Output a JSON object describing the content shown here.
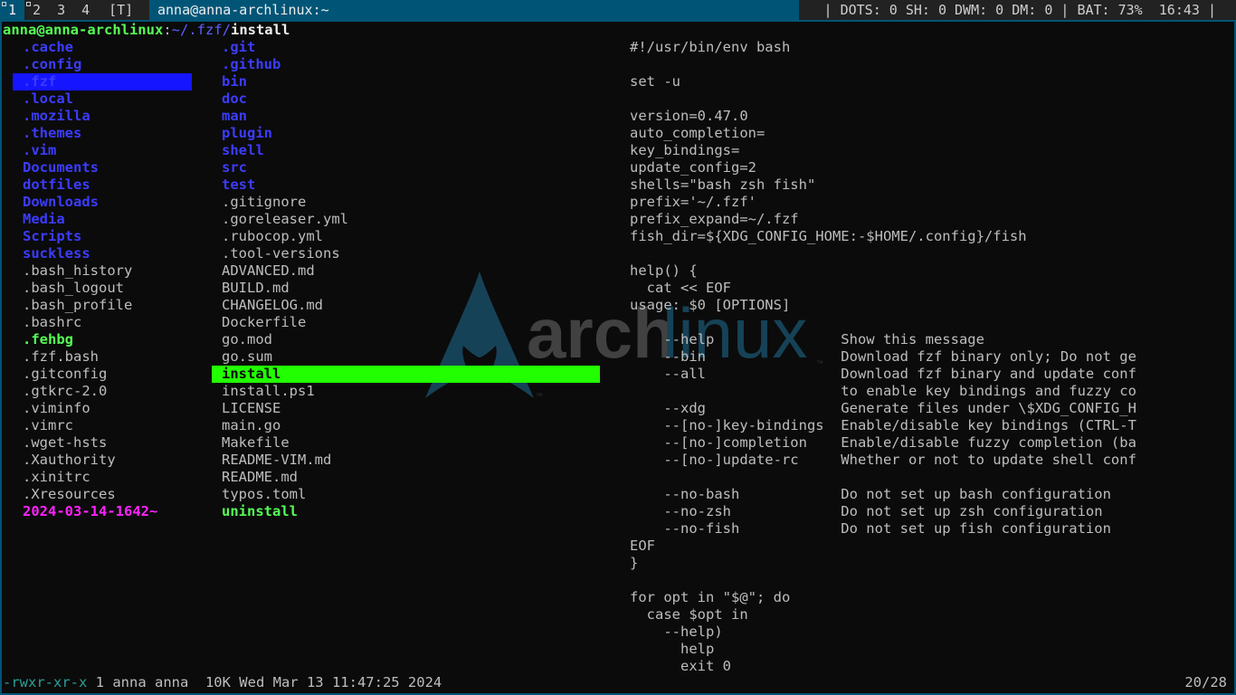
{
  "bar": {
    "tags": [
      "1",
      "2",
      "3",
      "4"
    ],
    "layout": "[T]",
    "window_title": "anna@anna-archlinux:~",
    "status": "| DOTS: 0 SH: 0 DWM: 0 DM: 0 | BAT: 73%  16:43 |"
  },
  "path": {
    "host": "anna@anna-archlinux",
    "sep": ":",
    "dir": "~/.fzf/",
    "file": "install"
  },
  "col1": [
    {
      "t": ".cache",
      "k": "dir"
    },
    {
      "t": ".config",
      "k": "dir"
    },
    {
      "t": ".fzf",
      "k": "dir"
    },
    {
      "t": ".local",
      "k": "dir"
    },
    {
      "t": ".mozilla",
      "k": "dir"
    },
    {
      "t": ".themes",
      "k": "dir"
    },
    {
      "t": ".vim",
      "k": "dir"
    },
    {
      "t": "Documents",
      "k": "dir"
    },
    {
      "t": "dotfiles",
      "k": "dir"
    },
    {
      "t": "Downloads",
      "k": "dir"
    },
    {
      "t": "Media",
      "k": "dir"
    },
    {
      "t": "Scripts",
      "k": "dir"
    },
    {
      "t": "suckless",
      "k": "dir"
    },
    {
      "t": ".bash_history",
      "k": "file"
    },
    {
      "t": ".bash_logout",
      "k": "file"
    },
    {
      "t": ".bash_profile",
      "k": "file"
    },
    {
      "t": ".bashrc",
      "k": "file"
    },
    {
      "t": ".fehbg",
      "k": "exec"
    },
    {
      "t": ".fzf.bash",
      "k": "file"
    },
    {
      "t": ".gitconfig",
      "k": "file"
    },
    {
      "t": ".gtkrc-2.0",
      "k": "file"
    },
    {
      "t": ".viminfo",
      "k": "file"
    },
    {
      "t": ".vimrc",
      "k": "file"
    },
    {
      "t": ".wget-hsts",
      "k": "file"
    },
    {
      "t": ".Xauthority",
      "k": "file"
    },
    {
      "t": ".xinitrc",
      "k": "file"
    },
    {
      "t": ".Xresources",
      "k": "file"
    },
    {
      "t": "2024-03-14-1642~",
      "k": "mag"
    }
  ],
  "col1_selected": 2,
  "col2": [
    {
      "t": ".git",
      "k": "dir"
    },
    {
      "t": ".github",
      "k": "dir"
    },
    {
      "t": "bin",
      "k": "dir"
    },
    {
      "t": "doc",
      "k": "dir"
    },
    {
      "t": "man",
      "k": "dir"
    },
    {
      "t": "plugin",
      "k": "dir"
    },
    {
      "t": "shell",
      "k": "dir"
    },
    {
      "t": "src",
      "k": "dir"
    },
    {
      "t": "test",
      "k": "dir"
    },
    {
      "t": ".gitignore",
      "k": "file"
    },
    {
      "t": ".goreleaser.yml",
      "k": "file"
    },
    {
      "t": ".rubocop.yml",
      "k": "file"
    },
    {
      "t": ".tool-versions",
      "k": "file"
    },
    {
      "t": "ADVANCED.md",
      "k": "file"
    },
    {
      "t": "BUILD.md",
      "k": "file"
    },
    {
      "t": "CHANGELOG.md",
      "k": "file"
    },
    {
      "t": "Dockerfile",
      "k": "file"
    },
    {
      "t": "go.mod",
      "k": "file"
    },
    {
      "t": "go.sum",
      "k": "file"
    },
    {
      "t": "install",
      "k": "exec"
    },
    {
      "t": "install.ps1",
      "k": "file"
    },
    {
      "t": "LICENSE",
      "k": "file"
    },
    {
      "t": "main.go",
      "k": "file"
    },
    {
      "t": "Makefile",
      "k": "file"
    },
    {
      "t": "README-VIM.md",
      "k": "file"
    },
    {
      "t": "README.md",
      "k": "file"
    },
    {
      "t": "typos.toml",
      "k": "file"
    },
    {
      "t": "uninstall",
      "k": "exec"
    }
  ],
  "col2_selected": 19,
  "preview": [
    "#!/usr/bin/env bash",
    "",
    "set -u",
    "",
    "version=0.47.0",
    "auto_completion=",
    "key_bindings=",
    "update_config=2",
    "shells=\"bash zsh fish\"",
    "prefix='~/.fzf'",
    "prefix_expand=~/.fzf",
    "fish_dir=${XDG_CONFIG_HOME:-$HOME/.config}/fish",
    "",
    "help() {",
    "  cat << EOF",
    "usage: $0 [OPTIONS]",
    "",
    "    --help               Show this message",
    "    --bin                Download fzf binary only; Do not ge",
    "    --all                Download fzf binary and update conf",
    "                         to enable key bindings and fuzzy co",
    "    --xdg                Generate files under \\$XDG_CONFIG_H",
    "    --[no-]key-bindings  Enable/disable key bindings (CTRL-T",
    "    --[no-]completion    Enable/disable fuzzy completion (ba",
    "    --[no-]update-rc     Whether or not to update shell conf",
    "",
    "    --no-bash            Do not set up bash configuration",
    "    --no-zsh             Do not set up zsh configuration",
    "    --no-fish            Do not set up fish configuration",
    "EOF",
    "}",
    "",
    "for opt in \"$@\"; do",
    "  case $opt in",
    "    --help)",
    "      help",
    "      exit 0"
  ],
  "footer": {
    "perms": "-rwxr-xr-x",
    "info": " 1 anna anna  10K Wed Mar 13 11:47:25 2024",
    "position": "20/28"
  },
  "logo": {
    "text_arch": "arch",
    "text_linux": "linux",
    "tm": "™"
  },
  "colors": {
    "accent": "#005577",
    "dir": "#3c3cff",
    "exec": "#55ff55",
    "special": "#ff22ff"
  }
}
